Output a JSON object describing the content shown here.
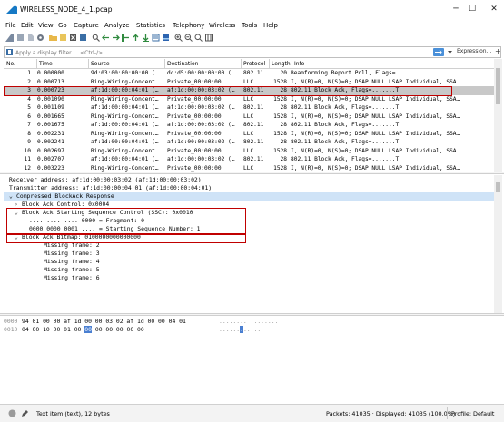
{
  "window": {
    "title": "WIRELESS_NODE_4_1.pcap",
    "minimize": "─",
    "maximize": "☐",
    "close": "✕"
  },
  "menu": [
    "File",
    "Edit",
    "View",
    "Go",
    "Capture",
    "Analyze",
    "Statistics",
    "Telephony",
    "Wireless",
    "Tools",
    "Help"
  ],
  "filter": {
    "placeholder": "Apply a display filter ... <Ctrl-/>",
    "expression_label": "Expression...",
    "add_label": "+"
  },
  "packet_list": {
    "columns": [
      "No.",
      "Time",
      "Source",
      "Destination",
      "Protocol",
      "Length",
      "Info"
    ],
    "rows": [
      [
        "1",
        "0.000000",
        "9d:03:00:00:00:00 (…",
        "dc:d5:00:00:00:00 (…",
        "802.11",
        "20",
        "Beamforming Report Poll, Flags=........"
      ],
      [
        "2",
        "0.000713",
        "Ring-Wiring-Concent…",
        "Private_00:00:00",
        "LLC",
        "1528",
        "I, N(R)=0, N(S)=0; DSAP NULL LSAP Individual, SSA…"
      ],
      [
        "3",
        "0.000723",
        "af:1d:00:00:04:01 (…",
        "af:1d:00:00:03:02 (…",
        "802.11",
        "28",
        "802.11 Block Ack, Flags=.......T"
      ],
      [
        "4",
        "0.001090",
        "Ring-Wiring-Concent…",
        "Private_00:00:00",
        "LLC",
        "1528",
        "I, N(R)=0, N(S)=0; DSAP NULL LSAP Individual, SSA…"
      ],
      [
        "5",
        "0.001109",
        "af:1d:00:00:04:01 (…",
        "af:1d:00:00:03:02 (…",
        "802.11",
        "28",
        "802.11 Block Ack, Flags=.......T"
      ],
      [
        "6",
        "0.001665",
        "Ring-Wiring-Concent…",
        "Private_00:00:00",
        "LLC",
        "1528",
        "I, N(R)=0, N(S)=0; DSAP NULL LSAP Individual, SSA…"
      ],
      [
        "7",
        "0.001675",
        "af:1d:00:00:04:01 (…",
        "af:1d:00:00:03:02 (…",
        "802.11",
        "28",
        "802.11 Block Ack, Flags=.......T"
      ],
      [
        "8",
        "0.002231",
        "Ring-Wiring-Concent…",
        "Private_00:00:00",
        "LLC",
        "1528",
        "I, N(R)=0, N(S)=0; DSAP NULL LSAP Individual, SSA…"
      ],
      [
        "9",
        "0.002241",
        "af:1d:00:00:04:01 (…",
        "af:1d:00:00:03:02 (…",
        "802.11",
        "28",
        "802.11 Block Ack, Flags=.......T"
      ],
      [
        "10",
        "0.002697",
        "Ring-Wiring-Concent…",
        "Private_00:00:00",
        "LLC",
        "1528",
        "I, N(R)=0, N(S)=0; DSAP NULL LSAP Individual, SSA…"
      ],
      [
        "11",
        "0.002707",
        "af:1d:00:00:04:01 (…",
        "af:1d:00:00:03:02 (…",
        "802.11",
        "28",
        "802.11 Block Ack, Flags=.......T"
      ],
      [
        "12",
        "0.003223",
        "Ring-Wiring-Concent…",
        "Private_00:00:00",
        "LLC",
        "1528",
        "I, N(R)=0, N(S)=0; DSAP NULL LSAP Individual, SSA…"
      ]
    ]
  },
  "details": {
    "receiver": "Receiver address: af:1d:00:00:03:02 (af:1d:00:00:03:02)",
    "transmitter": "Transmitter address: af:1d:00:00:04:01 (af:1d:00:00:04:01)",
    "compressed": "Compressed BlockAck Response",
    "control": "Block Ack Control: 0x0004",
    "ssc": "Block Ack Starting Sequence Control (SSC): 0x0010",
    "fragment": ".... .... .... 0000 = Fragment: 0",
    "seqnum": "0000 0000 0001 .... = Starting Sequence Number: 1",
    "bitmap": "Block Ack Bitmap: 0100000000000000",
    "missing": [
      "Missing frame: 2",
      "Missing frame: 3",
      "Missing frame: 4",
      "Missing frame: 5",
      "Missing frame: 6"
    ]
  },
  "bytes": {
    "rows": [
      {
        "offset": "0000",
        "hex": "94 01 00 00 af 1d 00 00  03 02 af 1d 00 00 04 01",
        "ascii": "........ ........"
      },
      {
        "offset": "0010",
        "hex_pre": "04 00 10 00 01 00",
        "hex_sel": "00",
        "hex_post": "00  00 00 00 00",
        "ascii_pre": "......",
        "ascii_sel": ".",
        "ascii_post": "....."
      }
    ]
  },
  "status": {
    "text": "Text item (text), 12 bytes",
    "packets": "Packets: 41035 · Displayed: 41035 (100.0%)",
    "profile": "Profile: Default"
  },
  "colors": {
    "selection_row": "#c8c8c8",
    "highlight_box": "#c00000",
    "tree_highlight": "#cfe3f7",
    "byte_highlight": "#4a7fd1"
  }
}
